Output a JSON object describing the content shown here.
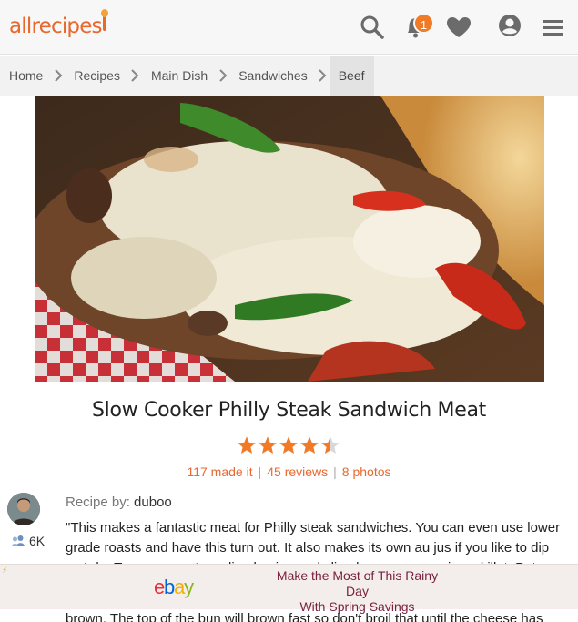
{
  "header": {
    "logo_text": "allrecipes",
    "notification_count": "1",
    "brand_color": "#e8682d",
    "icons": [
      "search-icon",
      "bell-icon",
      "heart-icon",
      "user-icon",
      "menu-icon"
    ]
  },
  "breadcrumb": {
    "items": [
      "Home",
      "Recipes",
      "Main Dish",
      "Sandwiches",
      "Beef"
    ]
  },
  "hero": {
    "image_subject": "cheesy steak sandwich with peppers and onions"
  },
  "recipe": {
    "title": "Slow Cooker Philly Steak Sandwich Meat",
    "rating": 4.5,
    "made_it": "117 made it",
    "reviews": "45 reviews",
    "photos": "8 photos",
    "recipe_by_label": "Recipe by:",
    "author": "duboo",
    "followers": "6K",
    "description": "\"This makes a fantastic meat for Philly steak sandwiches. You can even use lower grade roasts and have this turn out. It also makes its own au jus if you like to dip as I do. To serve, saute a sliced onion and sliced green pepper in a skillet. Put",
    "description_tail": "brown. The top of the bun will brown fast so don't broil that until the cheese has"
  },
  "ad": {
    "brand": "ebay",
    "line1": "Make the Most of This Rainy Day",
    "line2": "With Spring Savings",
    "colors": {
      "e": "#e53238",
      "b": "#0064d2",
      "a": "#f5af02",
      "y": "#86b817"
    }
  }
}
